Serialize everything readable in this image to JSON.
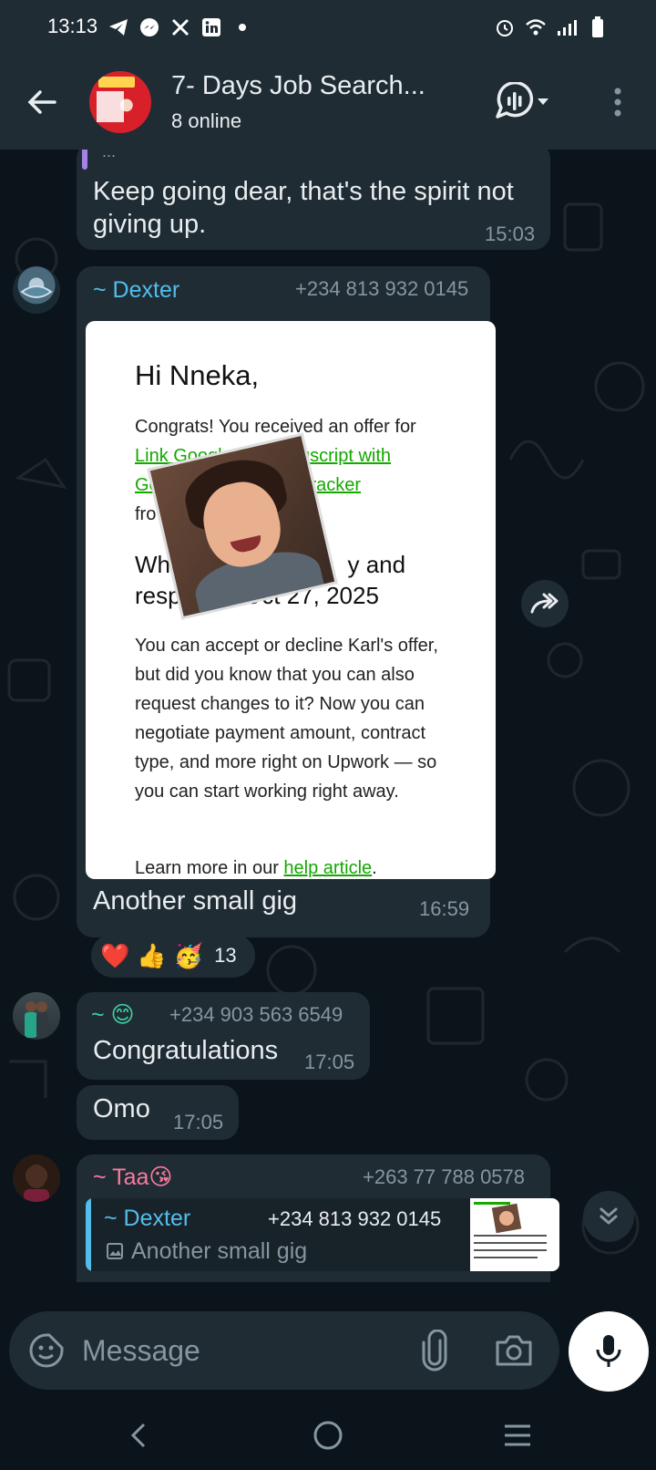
{
  "status_bar": {
    "time": "13:13"
  },
  "header": {
    "title": "7- Days Job Search...",
    "subtitle": "8 online"
  },
  "messages": [
    {
      "text": "Keep going dear, that's the spirit not giving up.",
      "time": "15:03",
      "quote_dots": "..."
    },
    {
      "sender": "~ Dexter",
      "phone": "+234 813 932 0145",
      "image": {
        "greeting": "Hi Nneka,",
        "p1_a": "Congrats! You received an offer for",
        "p1_link1": "Link Google D",
        "p1_link1b": "anuscript with",
        "p1_link2": "Go",
        "p1_link2b": "ack Tracker",
        "p1_c": "fro",
        "p1_d": "o!",
        "h_a": "Wha",
        "h_b": "y and",
        "h_c": "respo",
        "h_d": "Oct 27, 2025",
        "p2": "You can accept or decline Karl's offer, but did you know that you can also request changes to it? Now you can negotiate payment amount, contract type, and more right on Upwork — so you can start working right away.",
        "p3_a": "Learn more in our ",
        "p3_link": "help article",
        "p3_b": "."
      },
      "caption": "Another small gig",
      "time": "16:59",
      "reactions": {
        "emojis": [
          "❤️",
          "👍",
          "🥳"
        ],
        "count": "13"
      }
    },
    {
      "sender": "~ 😊",
      "phone": "+234 903 563 6549",
      "text": "Congratulations",
      "time": "17:05"
    },
    {
      "text": "Omo",
      "time": "17:05"
    },
    {
      "sender": "~ Taa😘",
      "phone": "+263 77 788 0578",
      "reply": {
        "sender": "~ Dexter",
        "phone": "+234 813 932 0145",
        "text": "Another small gig"
      }
    }
  ],
  "input": {
    "placeholder": "Message"
  },
  "colors": {
    "accent": "#00a884",
    "bubble": "#1f2c34",
    "bg": "#0b141a",
    "dexter": "#53bdeb",
    "taa": "#fc7aa0",
    "smile": "#3fcfa0"
  }
}
